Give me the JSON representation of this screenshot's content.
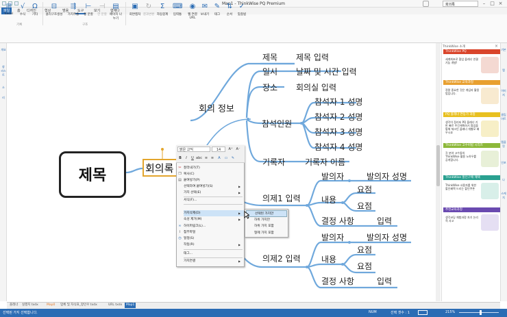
{
  "titlebar": {
    "title": "Map1 - ThinkWise PQ Premium",
    "search": "회의록"
  },
  "tabs": [
    "파일",
    "홈",
    "디자인",
    "형상",
    "범용",
    "도구",
    "보기",
    "협재나"
  ],
  "ribbon": {
    "items": [
      "Excel",
      "수식",
      "기타",
      "클리구조생성",
      "가지추출",
      "정 분할",
      "한 분할",
      "페이지 나누기",
      "회면캡처",
      "결과변환",
      "자동합계",
      "입력통",
      "웹 연결 URL",
      "보내기",
      "태그",
      "순서",
      "맞춤법"
    ],
    "groups": [
      "기록",
      "구조"
    ]
  },
  "left_toolbar": [
    "개요",
    "창 리스트",
    "소",
    "리"
  ],
  "map": {
    "root": "제목",
    "selected": "회의록",
    "meeting_info": "회의 정보",
    "fields": [
      {
        "label": "제목",
        "value": "제목 입력"
      },
      {
        "label": "일시",
        "value": "날짜 및 시간 입력"
      },
      {
        "label": "장소",
        "value": "회의실 입력"
      },
      {
        "label": "기록자",
        "value": "기록자 이름"
      }
    ],
    "attendees_label": "참석인원",
    "attendees": [
      "참석자 1 성명",
      "참석자 2 성명",
      "참석자 3 성명",
      "참석자 4 성명"
    ],
    "agenda": [
      {
        "title": "의제1 입력",
        "speaker_label": "발의자",
        "speaker": "발의자 성명",
        "content_label": "내용",
        "points": [
          "요점",
          "요점"
        ],
        "decision_label": "결정 사항",
        "decision": "입력"
      },
      {
        "title": "의제2 입력",
        "speaker_label": "발의자",
        "speaker": "발의자 성명",
        "content_label": "내용",
        "points": [
          "요점",
          "요점"
        ],
        "decision_label": "결정 사항",
        "decision": "입력"
      }
    ]
  },
  "context_menu": {
    "font": "맑은 고딕",
    "size": "14",
    "items": [
      "잘라내기(T)",
      "복사(C)",
      "붙여넣기(P)",
      "선택하여 붙여넣기(S)",
      "가지 선택(E)",
      "서식(F)...",
      "가지삭제(D)",
      "속성 제거(M)",
      "하이퍼링크(L)...",
      "첨부파일",
      "일정(S)",
      "작동(R)",
      "태그...",
      "가지연결"
    ],
    "submenu": [
      "선택된 가지만",
      "하위 가지만",
      "하위 가지 포함",
      "형제 가지 포함"
    ]
  },
  "side_panel": {
    "title": "ThinkWise 소개",
    "cards": [
      {
        "head": "ThinkWise PQ",
        "text": "세계최초로 협업 플래너 연결기능 개발!",
        "color": "#d9452b"
      },
      {
        "head": "ThinkWise 교육과정",
        "text": "정말 중요한 것은 개념과 활용법입니다.",
        "color": "#e8a030"
      },
      {
        "head": "PQ 플래너 연동가 과정",
        "text": "생각이 정리되 PQ 플래너 기반 빠르 주간계획하기 협업을 통해 체크인 플래너 개별모 배우시죠",
        "color": "#e8c020"
      },
      {
        "head": "ThinkWise 고수비법 시리즈",
        "text": "각 분야 고수들의 ThinkWise 활용 노하우를 공개합니다.",
        "color": "#8db83a"
      },
      {
        "head": "ThinkWise 할인구매 혜택",
        "text": "ThinkWise 사용자를 위한 할인혜택 드리는 할인쿠폰",
        "color": "#2aa090"
      },
      {
        "head": "추천교육과정",
        "text": "생각코딩 체험과정 자기 논리적 사고",
        "color": "#6a4ab0"
      }
    ]
  },
  "right_toolbar": [
    "기본",
    "맵",
    "이미지",
    "클립아트",
    "템플릿",
    "인포",
    "나",
    "스케치"
  ],
  "doc_tabs": [
    "플래너",
    "실행지 txdx",
    "Map0",
    "업체 및 자식표_항인우 txdx",
    "URL txdx",
    "Map1"
  ],
  "status": {
    "left": "선택된 가지 선택합니다.",
    "num": "NUM",
    "count": "선택 갯수 : 1",
    "zoom": "215%"
  }
}
